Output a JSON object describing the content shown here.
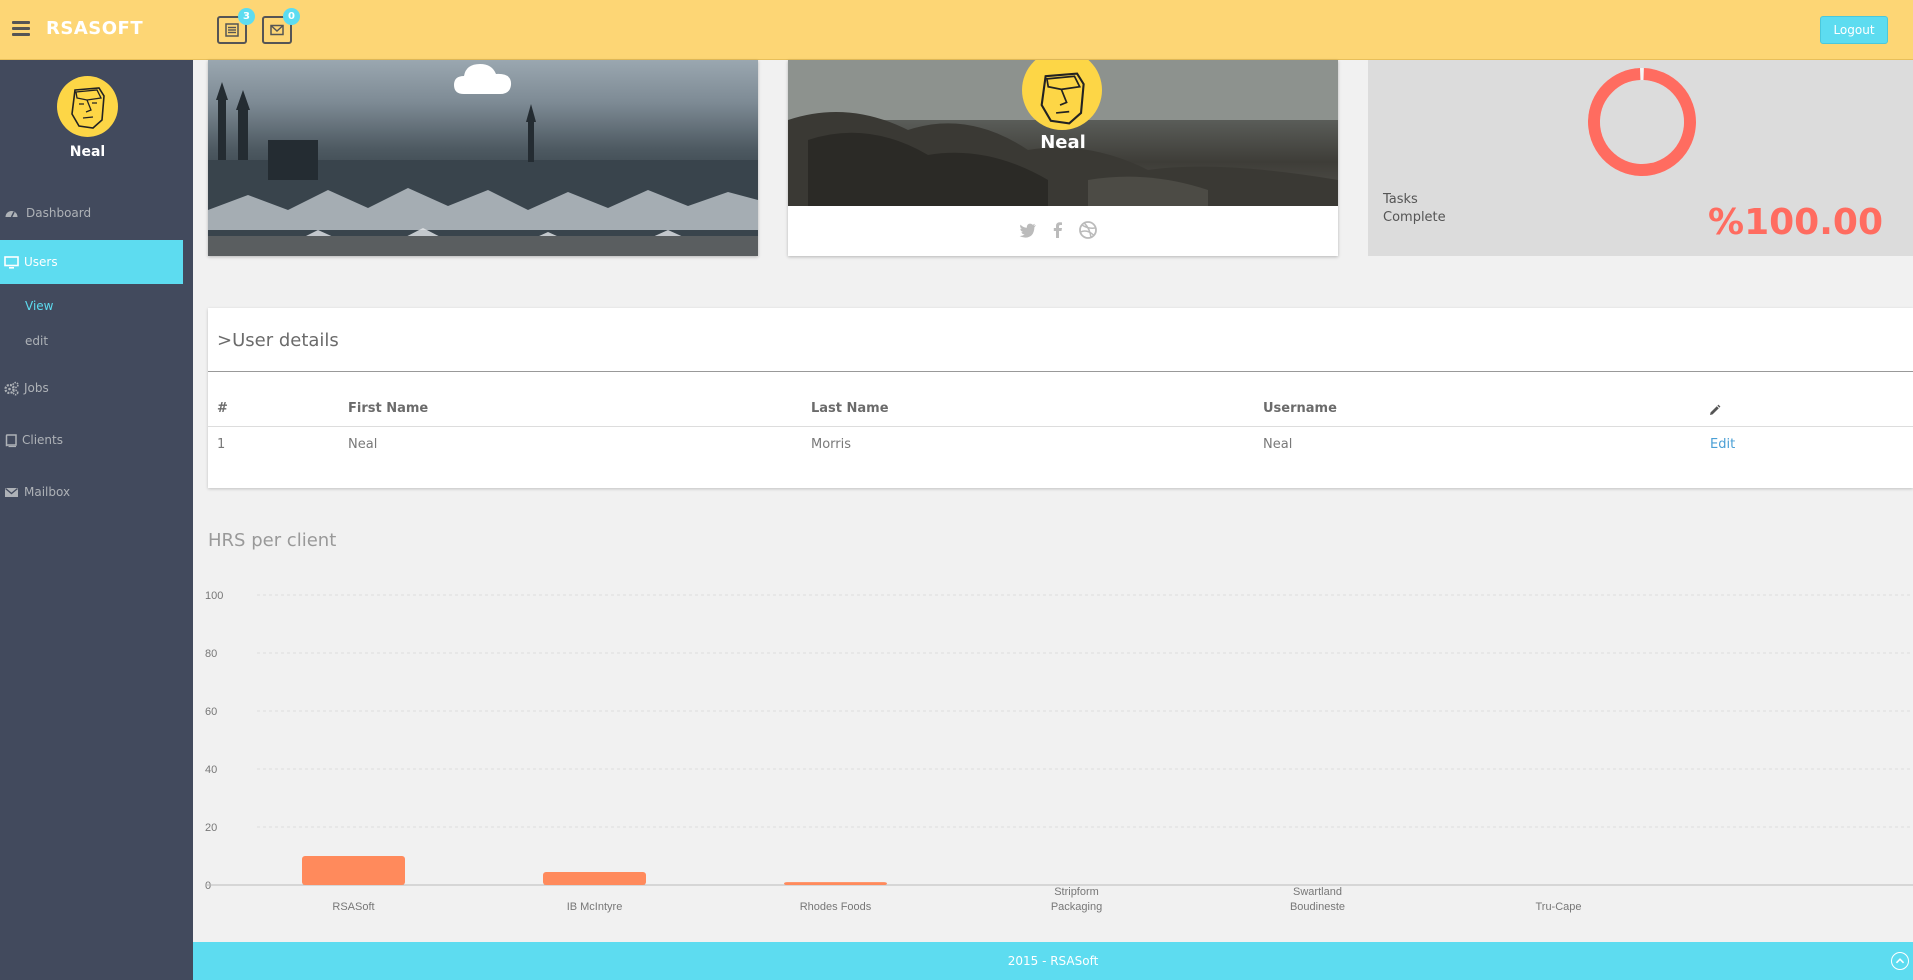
{
  "app": {
    "brand": "RSASOFT"
  },
  "header": {
    "tasks_badge": "3",
    "mail_badge": "0",
    "logout_label": "Logout"
  },
  "sidebar": {
    "user_name": "Neal",
    "items": [
      {
        "label": "Dashboard",
        "icon": "dashboard-icon"
      },
      {
        "label": "Users",
        "icon": "desktop-icon"
      },
      {
        "label": "Jobs",
        "icon": "cogs-icon"
      },
      {
        "label": "Clients",
        "icon": "book-icon"
      },
      {
        "label": "Mailbox",
        "icon": "envelope-icon"
      }
    ],
    "sub_items": [
      {
        "label": "View"
      },
      {
        "label": "edit"
      }
    ]
  },
  "profile_card": {
    "name": "Neal"
  },
  "tasks_card": {
    "label_line1": "Tasks",
    "label_line2": "Complete",
    "percent": "%100.00",
    "progress": 1.0,
    "color": "#ff6c60"
  },
  "user_details": {
    "title": ">User details",
    "columns": [
      "#",
      "First Name",
      "Last Name",
      "Username"
    ],
    "rows": [
      {
        "num": "1",
        "first": "Neal",
        "last": "Morris",
        "username": "Neal",
        "action": "Edit"
      }
    ]
  },
  "chart_section": {
    "title": "HRS per client"
  },
  "chart_data": {
    "type": "bar",
    "categories": [
      "RSASoft",
      "IB McIntyre",
      "Rhodes Foods",
      "Stripform Packaging",
      "Swartland Boudineste",
      "Tru-Cape"
    ],
    "values": [
      10,
      4.5,
      1,
      0,
      0,
      0
    ],
    "yticks": [
      0,
      20,
      40,
      60,
      80,
      100
    ],
    "ylim": [
      0,
      100
    ],
    "bar_color": "#ff8a5c",
    "grid": true
  },
  "footer": {
    "text": "2015 - RSASoft"
  }
}
